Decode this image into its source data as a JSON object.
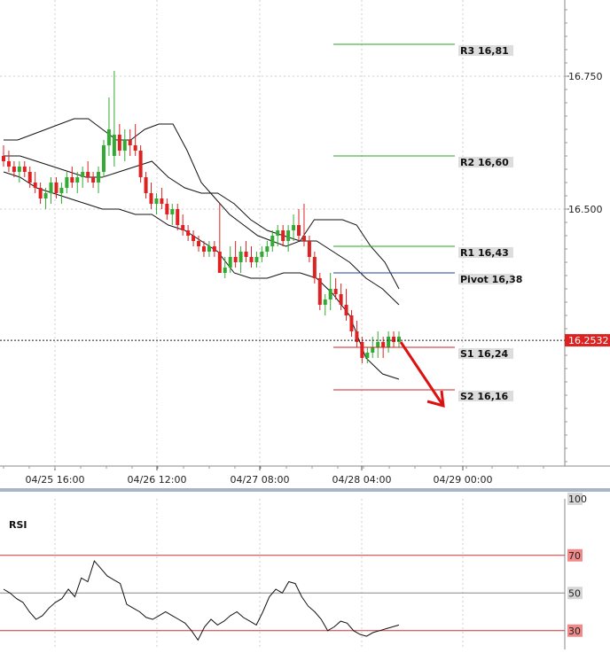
{
  "chart_data": [
    {
      "type": "candlestick",
      "x_ticks": [
        "04/25 16:00",
        "04/26 12:00",
        "04/27 08:00",
        "04/28 04:00",
        "04/29 00:00"
      ],
      "y_ticks": [
        "16.750",
        "16.500"
      ],
      "ylim": [
        16.07,
        16.9
      ],
      "grid": true,
      "last_price": "16.2532",
      "pivot_levels": [
        {
          "label": "R3 16,81",
          "value": 16.81,
          "color": "#22aa22"
        },
        {
          "label": "R2 16,60",
          "value": 16.6,
          "color": "#22aa22"
        },
        {
          "label": "R1 16,43",
          "value": 16.43,
          "color": "#22aa22"
        },
        {
          "label": "Pivot 16,38",
          "value": 16.38,
          "color": "#1f3f9f"
        },
        {
          "label": "S1 16,24",
          "value": 16.24,
          "color": "#cc2222"
        },
        {
          "label": "S2 16,16",
          "value": 16.16,
          "color": "#cc2222"
        }
      ],
      "annotation": {
        "type": "arrow",
        "direction": "down",
        "from_value": 16.25,
        "to_value": 16.13,
        "color": "#dd1111"
      },
      "candles": [
        [
          16.6,
          16.62,
          16.58,
          16.59
        ],
        [
          16.59,
          16.61,
          16.57,
          16.58
        ],
        [
          16.58,
          16.59,
          16.56,
          16.57
        ],
        [
          16.57,
          16.59,
          16.55,
          16.58
        ],
        [
          16.58,
          16.59,
          16.56,
          16.57
        ],
        [
          16.57,
          16.58,
          16.54,
          16.55
        ],
        [
          16.55,
          16.57,
          16.53,
          16.54
        ],
        [
          16.54,
          16.55,
          16.51,
          16.52
        ],
        [
          16.52,
          16.54,
          16.5,
          16.53
        ],
        [
          16.53,
          16.56,
          16.51,
          16.55
        ],
        [
          16.55,
          16.56,
          16.52,
          16.53
        ],
        [
          16.53,
          16.55,
          16.51,
          16.54
        ],
        [
          16.54,
          16.57,
          16.53,
          16.56
        ],
        [
          16.56,
          16.58,
          16.54,
          16.55
        ],
        [
          16.55,
          16.57,
          16.53,
          16.56
        ],
        [
          16.56,
          16.58,
          16.54,
          16.57
        ],
        [
          16.57,
          16.59,
          16.55,
          16.56
        ],
        [
          16.56,
          16.57,
          16.54,
          16.55
        ],
        [
          16.55,
          16.58,
          16.53,
          16.57
        ],
        [
          16.57,
          16.63,
          16.56,
          16.62
        ],
        [
          16.62,
          16.71,
          16.6,
          16.65
        ],
        [
          16.6,
          16.76,
          16.58,
          16.64
        ],
        [
          16.64,
          16.66,
          16.6,
          16.61
        ],
        [
          16.61,
          16.65,
          16.59,
          16.63
        ],
        [
          16.63,
          16.65,
          16.6,
          16.62
        ],
        [
          16.62,
          16.66,
          16.6,
          16.61
        ],
        [
          16.61,
          16.62,
          16.55,
          16.56
        ],
        [
          16.56,
          16.57,
          16.52,
          16.53
        ],
        [
          16.53,
          16.55,
          16.5,
          16.51
        ],
        [
          16.51,
          16.53,
          16.49,
          16.52
        ],
        [
          16.52,
          16.54,
          16.5,
          16.51
        ],
        [
          16.51,
          16.52,
          16.48,
          16.49
        ],
        [
          16.49,
          16.51,
          16.47,
          16.5
        ],
        [
          16.5,
          16.51,
          16.46,
          16.47
        ],
        [
          16.47,
          16.49,
          16.45,
          16.46
        ],
        [
          16.46,
          16.47,
          16.44,
          16.45
        ],
        [
          16.45,
          16.46,
          16.43,
          16.44
        ],
        [
          16.44,
          16.45,
          16.42,
          16.43
        ],
        [
          16.43,
          16.44,
          16.41,
          16.42
        ],
        [
          16.42,
          16.44,
          16.41,
          16.43
        ],
        [
          16.43,
          16.44,
          16.41,
          16.42
        ],
        [
          16.42,
          16.51,
          16.39,
          16.38
        ],
        [
          16.38,
          16.41,
          16.37,
          16.39
        ],
        [
          16.39,
          16.43,
          16.38,
          16.41
        ],
        [
          16.41,
          16.44,
          16.39,
          16.4
        ],
        [
          16.4,
          16.43,
          16.38,
          16.42
        ],
        [
          16.42,
          16.44,
          16.4,
          16.41
        ],
        [
          16.41,
          16.43,
          16.39,
          16.4
        ],
        [
          16.4,
          16.42,
          16.39,
          16.41
        ],
        [
          16.41,
          16.43,
          16.4,
          16.42
        ],
        [
          16.42,
          16.44,
          16.41,
          16.43
        ],
        [
          16.43,
          16.46,
          16.42,
          16.45
        ],
        [
          16.45,
          16.47,
          16.43,
          16.46
        ],
        [
          16.46,
          16.47,
          16.43,
          16.44
        ],
        [
          16.44,
          16.47,
          16.42,
          16.46
        ],
        [
          16.46,
          16.49,
          16.44,
          16.47
        ],
        [
          16.47,
          16.5,
          16.44,
          16.45
        ],
        [
          16.45,
          16.51,
          16.43,
          16.44
        ],
        [
          16.44,
          16.45,
          16.4,
          16.41
        ],
        [
          16.41,
          16.42,
          16.36,
          16.37
        ],
        [
          16.37,
          16.38,
          16.31,
          16.32
        ],
        [
          16.32,
          16.34,
          16.3,
          16.33
        ],
        [
          16.33,
          16.38,
          16.31,
          16.35
        ],
        [
          16.35,
          16.37,
          16.33,
          16.34
        ],
        [
          16.34,
          16.36,
          16.31,
          16.32
        ],
        [
          16.32,
          16.35,
          16.29,
          16.3
        ],
        [
          16.3,
          16.31,
          16.26,
          16.27
        ],
        [
          16.27,
          16.29,
          16.24,
          16.25
        ],
        [
          16.25,
          16.26,
          16.21,
          16.22
        ],
        [
          16.22,
          16.24,
          16.21,
          16.23
        ],
        [
          16.23,
          16.26,
          16.22,
          16.24
        ],
        [
          16.24,
          16.27,
          16.22,
          16.25
        ],
        [
          16.25,
          16.26,
          16.22,
          16.24
        ],
        [
          16.24,
          16.27,
          16.23,
          16.26
        ],
        [
          16.26,
          16.27,
          16.24,
          16.25
        ],
        [
          16.25,
          16.27,
          16.24,
          16.26
        ]
      ],
      "bollinger": {
        "upper": [
          16.63,
          16.63,
          16.64,
          16.65,
          16.66,
          16.67,
          16.67,
          16.65,
          16.63,
          16.63,
          16.65,
          16.66,
          16.66,
          16.61,
          16.55,
          16.52,
          16.49,
          16.47,
          16.45,
          16.44,
          16.43,
          16.44,
          16.48,
          16.48,
          16.48,
          16.47,
          16.43,
          16.4,
          16.35
        ],
        "middle": [
          16.6,
          16.6,
          16.59,
          16.58,
          16.57,
          16.56,
          16.56,
          16.57,
          16.58,
          16.59,
          16.56,
          16.54,
          16.53,
          16.53,
          16.51,
          16.48,
          16.46,
          16.45,
          16.44,
          16.44,
          16.42,
          16.4,
          16.37,
          16.35,
          16.32
        ],
        "lower": [
          16.57,
          16.56,
          16.54,
          16.53,
          16.52,
          16.51,
          16.5,
          16.5,
          16.49,
          16.49,
          16.47,
          16.46,
          16.44,
          16.42,
          16.38,
          16.37,
          16.37,
          16.38,
          16.38,
          16.37,
          16.34,
          16.3,
          16.22,
          16.19,
          16.18
        ]
      }
    },
    {
      "type": "line",
      "title": "RSI",
      "y_ticks": [
        "100",
        "70",
        "50",
        "30"
      ],
      "ylim": [
        20,
        100
      ],
      "levels": [
        {
          "value": 70,
          "color": "#cc3333"
        },
        {
          "value": 50,
          "color": "#888888"
        },
        {
          "value": 30,
          "color": "#cc3333"
        }
      ],
      "values": [
        52,
        50,
        47,
        45,
        40,
        36,
        38,
        42,
        45,
        47,
        52,
        48,
        58,
        56,
        67,
        63,
        59,
        57,
        55,
        44,
        42,
        40,
        37,
        36,
        38,
        40,
        38,
        36,
        34,
        30,
        25,
        32,
        36,
        33,
        35,
        38,
        40,
        37,
        35,
        33,
        40,
        48,
        52,
        50,
        56,
        55,
        48,
        43,
        40,
        36,
        30,
        32,
        35,
        34,
        30,
        28,
        27,
        29,
        30,
        31,
        32,
        33
      ]
    }
  ]
}
